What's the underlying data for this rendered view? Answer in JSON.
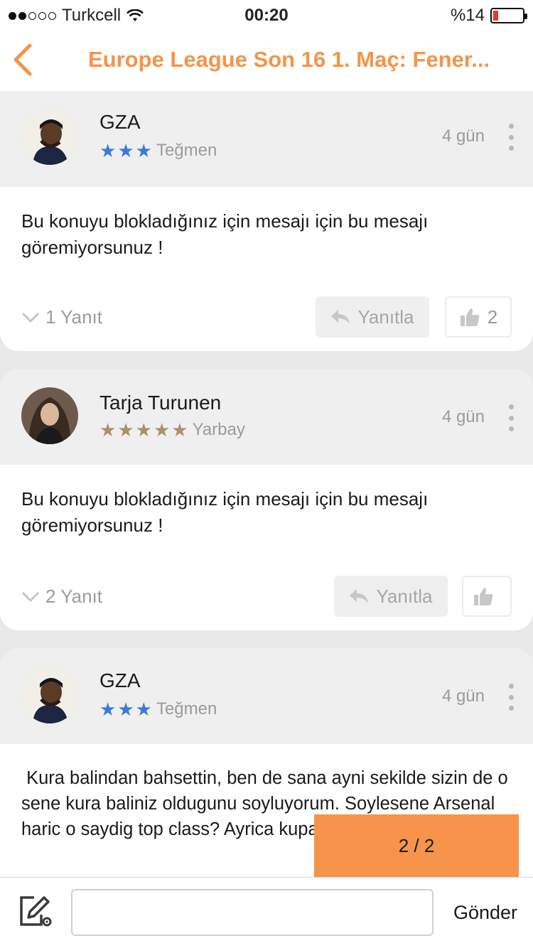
{
  "status_bar": {
    "carrier": "Turkcell",
    "time": "00:20",
    "battery": "%14",
    "signal_bars": 2
  },
  "nav": {
    "title": "Europe League Son 16 1. Maç: Fener...",
    "accent_color": "#f5944a"
  },
  "posts": [
    {
      "user": "GZA",
      "rank": "Teğmen",
      "stars": 3,
      "star_color": "#3a7bd5",
      "time": "4 gün",
      "text": "Bu konuyu blokladığınız için mesajı için bu mesajı göremiyorsunuz !",
      "replies": "1 Yanıt",
      "reply_label": "Yanıtla",
      "likes": "2"
    },
    {
      "user": "Tarja Turunen",
      "rank": "Yarbay",
      "stars": 5,
      "star_color": "#a8916c",
      "time": "4 gün",
      "text": "Bu konuyu blokladığınız için mesajı için bu mesajı göremiyorsunuz !",
      "replies": "2 Yanıt",
      "reply_label": "Yanıtla",
      "likes": ""
    },
    {
      "user": "GZA",
      "rank": "Teğmen",
      "stars": 3,
      "star_color": "#3a7bd5",
      "time": "4 gün",
      "text": " Kura balindan bahsettin, ben de sana ayni sekilde sizin de o sene kura baliniz oldugunu soyluyorum. Soylesene Arsenal haric o saydig top class? Ayrica kupayi balina a"
    }
  ],
  "pagination": {
    "label": "2 / 2"
  },
  "composer": {
    "placeholder": "",
    "send_label": "Gönder"
  }
}
